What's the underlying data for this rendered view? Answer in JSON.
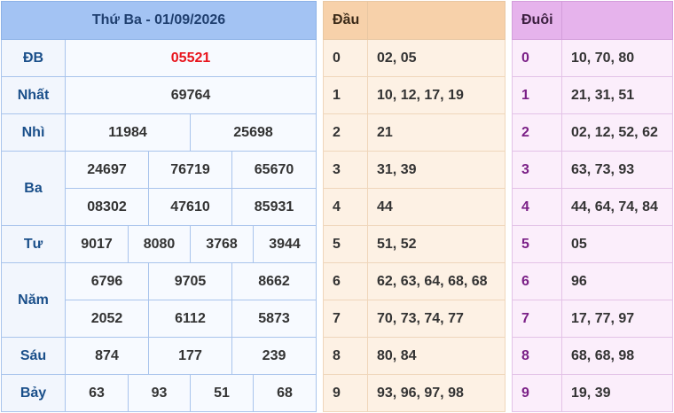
{
  "results": {
    "title": "Thứ Ba - 01/09/2026",
    "prizes": {
      "db": {
        "label": "ĐB",
        "values": [
          "05521"
        ]
      },
      "nhat": {
        "label": "Nhất",
        "values": [
          "69764"
        ]
      },
      "nhi": {
        "label": "Nhì",
        "values": [
          "11984",
          "25698"
        ]
      },
      "ba": {
        "label": "Ba",
        "values": [
          "24697",
          "76719",
          "65670",
          "08302",
          "47610",
          "85931"
        ]
      },
      "tu": {
        "label": "Tư",
        "values": [
          "9017",
          "8080",
          "3768",
          "3944"
        ]
      },
      "nam": {
        "label": "Năm",
        "values": [
          "6796",
          "9705",
          "8662",
          "2052",
          "6112",
          "5873"
        ]
      },
      "sau": {
        "label": "Sáu",
        "values": [
          "874",
          "177",
          "239"
        ]
      },
      "bay": {
        "label": "Bảy",
        "values": [
          "63",
          "93",
          "51",
          "68"
        ]
      }
    },
    "colors": {
      "special": "#e8141c",
      "header": "#a3c3f3"
    }
  },
  "heads": {
    "title": "Đầu",
    "rows": [
      {
        "key": "0",
        "values": "02, 05"
      },
      {
        "key": "1",
        "values": "10, 12, 17, 19"
      },
      {
        "key": "2",
        "values": "21"
      },
      {
        "key": "3",
        "values": "31, 39"
      },
      {
        "key": "4",
        "values": "44"
      },
      {
        "key": "5",
        "values": "51, 52"
      },
      {
        "key": "6",
        "values": "62, 63, 64, 68, 68"
      },
      {
        "key": "7",
        "values": "70, 73, 74, 77"
      },
      {
        "key": "8",
        "values": "80, 84"
      },
      {
        "key": "9",
        "values": "93, 96, 97, 98"
      }
    ]
  },
  "tails": {
    "title": "Đuôi",
    "rows": [
      {
        "key": "0",
        "values": "10, 70, 80"
      },
      {
        "key": "1",
        "values": "21, 31, 51"
      },
      {
        "key": "2",
        "values": "02, 12, 52, 62"
      },
      {
        "key": "3",
        "values": "63, 73, 93"
      },
      {
        "key": "4",
        "values": "44, 64, 74, 84"
      },
      {
        "key": "5",
        "values": "05"
      },
      {
        "key": "6",
        "values": "96"
      },
      {
        "key": "7",
        "values": "17, 77, 97"
      },
      {
        "key": "8",
        "values": "68, 68, 98"
      },
      {
        "key": "9",
        "values": "19, 39"
      }
    ]
  }
}
